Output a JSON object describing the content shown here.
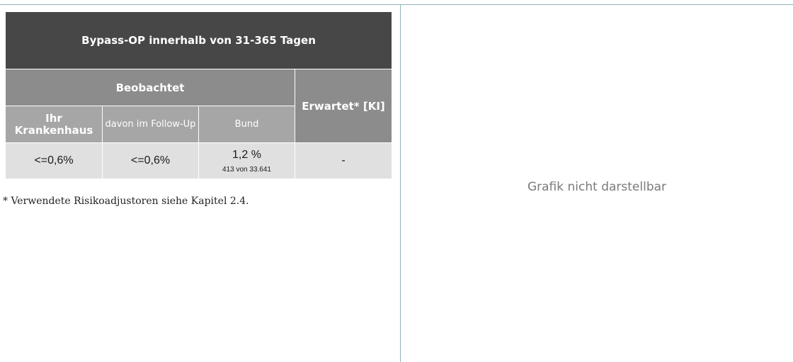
{
  "table": {
    "title": "Bypass-OP innerhalb von 31-365 Tagen",
    "observed_header": "Beobachtet",
    "expected_header": "Erwartet* [KI]",
    "sub_headers": {
      "hospital": "Ihr Krankenhaus",
      "followup": "davon im Follow-Up",
      "federal": "Bund"
    },
    "values": {
      "hospital": "<=0,6%",
      "followup": "<=0,6%",
      "federal": "1,2 %",
      "federal_detail": "413 von 33.641",
      "expected": "-"
    }
  },
  "footnote": "* Verwendete Risikoadjustoren siehe Kapitel 2.4.",
  "graphic_placeholder": "Grafik nicht darstellbar"
}
